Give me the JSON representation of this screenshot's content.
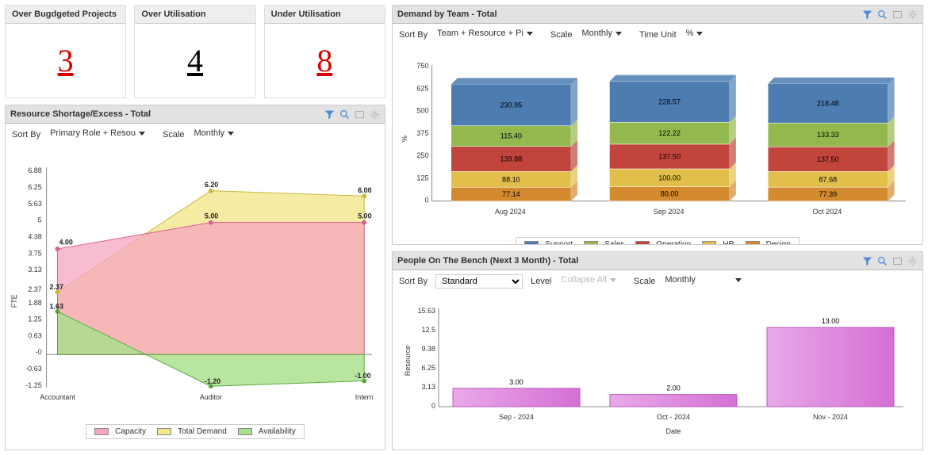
{
  "kpis": {
    "overbudget": {
      "title": "Over Bugdgeted Projects",
      "value": "3",
      "color": "red"
    },
    "overutil": {
      "title": "Over Utilisation",
      "value": "4",
      "color": "black"
    },
    "underutil": {
      "title": "Under Utilisation",
      "value": "8",
      "color": "red"
    }
  },
  "resource_panel": {
    "title": "Resource Shortage/Excess - Total",
    "sort_by_label": "Sort By",
    "sort_by_value": "Primary Role + Resou",
    "scale_label": "Scale",
    "scale_value": "Monthly",
    "ylabel": "FTE",
    "categories": [
      "Accountant",
      "Auditor",
      "Intern"
    ],
    "yticks": [
      "-1.25",
      "-0.63",
      "-0",
      "0.63",
      "1.25",
      "1.88",
      "2.37",
      "3.13",
      "3.75",
      "4.38",
      "5",
      "5.63",
      "6.25",
      "6.88"
    ],
    "legend": [
      "Capacity",
      "Total Demand",
      "Availability"
    ],
    "chart_data": {
      "type": "area",
      "series": [
        {
          "name": "Capacity",
          "values": [
            4.0,
            5.0,
            5.0
          ]
        },
        {
          "name": "Total Demand",
          "values": [
            2.37,
            6.2,
            6.0
          ]
        },
        {
          "name": "Availability",
          "values": [
            1.63,
            -1.2,
            -1.0
          ]
        }
      ]
    },
    "point_labels": {
      "acc_cap": "4.00",
      "acc_dem": "2.37",
      "acc_av": "1.63",
      "aud_cap": "5.00",
      "aud_dem": "6.20",
      "aud_av": "-1.20",
      "int_cap": "5.00",
      "int_dem": "6.00",
      "int_av": "-1.00"
    }
  },
  "demand_panel": {
    "title": "Demand by Team - Total",
    "sort_by_label": "Sort By",
    "sort_by_value": "Team + Resource + Pi",
    "scale_label": "Scale",
    "scale_value": "Monthly",
    "time_unit_label": "Time Unit",
    "time_unit_value": "%",
    "ylabel": "%",
    "categories": [
      "Aug 2024",
      "Sep 2024",
      "Oct 2024"
    ],
    "yticks": [
      "0",
      "125",
      "250",
      "375",
      "500",
      "625",
      "750"
    ],
    "legend": [
      "Support",
      "Sales",
      "Operation",
      "HR",
      "Design"
    ],
    "chart_data": {
      "type": "bar",
      "stacked": true,
      "series": [
        {
          "name": "Design",
          "values": [
            77.14,
            80.0,
            77.39
          ]
        },
        {
          "name": "HR",
          "values": [
            88.1,
            100.0,
            87.68
          ]
        },
        {
          "name": "Operation",
          "values": [
            139.88,
            137.5,
            137.5
          ]
        },
        {
          "name": "Sales",
          "values": [
            115.4,
            122.22,
            133.33
          ]
        },
        {
          "name": "Support",
          "values": [
            230.95,
            228.57,
            218.48
          ]
        }
      ]
    }
  },
  "bench_panel": {
    "title": "People On The Bench (Next 3 Month) - Total",
    "sort_by_label": "Sort By",
    "sort_by_value": "Standard",
    "level_label": "Level",
    "level_value": "Collapse All",
    "scale_label": "Scale",
    "scale_value": "Monthly",
    "ylabel": "Resource",
    "xlabel": "Date",
    "categories": [
      "Sep - 2024",
      "Oct - 2024",
      "Nov - 2024"
    ],
    "yticks": [
      "0",
      "3.13",
      "6.25",
      "9.38",
      "12.5",
      "15.63"
    ],
    "chart_data": {
      "type": "bar",
      "values": [
        3.0,
        2.0,
        13.0
      ],
      "labels": [
        "3.00",
        "2.00",
        "13.00"
      ]
    }
  },
  "colors": {
    "capacity": "#f5a6c0",
    "demand": "#f3e68c",
    "avail": "#a6e08a",
    "support": "#4d7db0",
    "sales": "#94b84d",
    "operation": "#c1453d",
    "hr": "#e2bf4a",
    "design": "#d48a2e",
    "bench": "#d56fd5"
  }
}
